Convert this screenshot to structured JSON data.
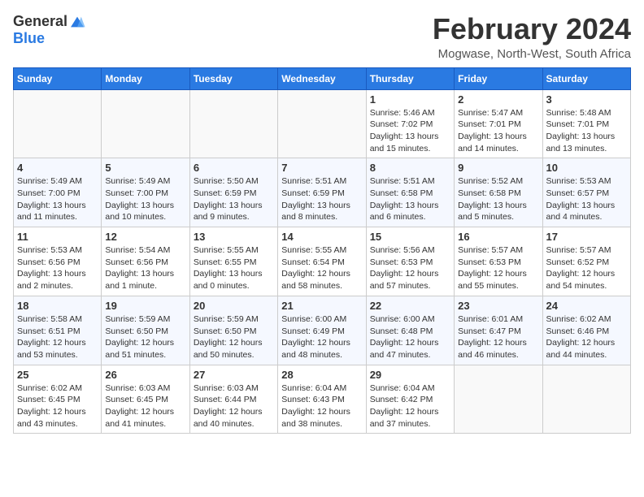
{
  "logo": {
    "general": "General",
    "blue": "Blue"
  },
  "title": "February 2024",
  "location": "Mogwase, North-West, South Africa",
  "days_of_week": [
    "Sunday",
    "Monday",
    "Tuesday",
    "Wednesday",
    "Thursday",
    "Friday",
    "Saturday"
  ],
  "weeks": [
    [
      {
        "day": "",
        "info": ""
      },
      {
        "day": "",
        "info": ""
      },
      {
        "day": "",
        "info": ""
      },
      {
        "day": "",
        "info": ""
      },
      {
        "day": "1",
        "info": "Sunrise: 5:46 AM\nSunset: 7:02 PM\nDaylight: 13 hours\nand 15 minutes."
      },
      {
        "day": "2",
        "info": "Sunrise: 5:47 AM\nSunset: 7:01 PM\nDaylight: 13 hours\nand 14 minutes."
      },
      {
        "day": "3",
        "info": "Sunrise: 5:48 AM\nSunset: 7:01 PM\nDaylight: 13 hours\nand 13 minutes."
      }
    ],
    [
      {
        "day": "4",
        "info": "Sunrise: 5:49 AM\nSunset: 7:00 PM\nDaylight: 13 hours\nand 11 minutes."
      },
      {
        "day": "5",
        "info": "Sunrise: 5:49 AM\nSunset: 7:00 PM\nDaylight: 13 hours\nand 10 minutes."
      },
      {
        "day": "6",
        "info": "Sunrise: 5:50 AM\nSunset: 6:59 PM\nDaylight: 13 hours\nand 9 minutes."
      },
      {
        "day": "7",
        "info": "Sunrise: 5:51 AM\nSunset: 6:59 PM\nDaylight: 13 hours\nand 8 minutes."
      },
      {
        "day": "8",
        "info": "Sunrise: 5:51 AM\nSunset: 6:58 PM\nDaylight: 13 hours\nand 6 minutes."
      },
      {
        "day": "9",
        "info": "Sunrise: 5:52 AM\nSunset: 6:58 PM\nDaylight: 13 hours\nand 5 minutes."
      },
      {
        "day": "10",
        "info": "Sunrise: 5:53 AM\nSunset: 6:57 PM\nDaylight: 13 hours\nand 4 minutes."
      }
    ],
    [
      {
        "day": "11",
        "info": "Sunrise: 5:53 AM\nSunset: 6:56 PM\nDaylight: 13 hours\nand 2 minutes."
      },
      {
        "day": "12",
        "info": "Sunrise: 5:54 AM\nSunset: 6:56 PM\nDaylight: 13 hours\nand 1 minute."
      },
      {
        "day": "13",
        "info": "Sunrise: 5:55 AM\nSunset: 6:55 PM\nDaylight: 13 hours\nand 0 minutes."
      },
      {
        "day": "14",
        "info": "Sunrise: 5:55 AM\nSunset: 6:54 PM\nDaylight: 12 hours\nand 58 minutes."
      },
      {
        "day": "15",
        "info": "Sunrise: 5:56 AM\nSunset: 6:53 PM\nDaylight: 12 hours\nand 57 minutes."
      },
      {
        "day": "16",
        "info": "Sunrise: 5:57 AM\nSunset: 6:53 PM\nDaylight: 12 hours\nand 55 minutes."
      },
      {
        "day": "17",
        "info": "Sunrise: 5:57 AM\nSunset: 6:52 PM\nDaylight: 12 hours\nand 54 minutes."
      }
    ],
    [
      {
        "day": "18",
        "info": "Sunrise: 5:58 AM\nSunset: 6:51 PM\nDaylight: 12 hours\nand 53 minutes."
      },
      {
        "day": "19",
        "info": "Sunrise: 5:59 AM\nSunset: 6:50 PM\nDaylight: 12 hours\nand 51 minutes."
      },
      {
        "day": "20",
        "info": "Sunrise: 5:59 AM\nSunset: 6:50 PM\nDaylight: 12 hours\nand 50 minutes."
      },
      {
        "day": "21",
        "info": "Sunrise: 6:00 AM\nSunset: 6:49 PM\nDaylight: 12 hours\nand 48 minutes."
      },
      {
        "day": "22",
        "info": "Sunrise: 6:00 AM\nSunset: 6:48 PM\nDaylight: 12 hours\nand 47 minutes."
      },
      {
        "day": "23",
        "info": "Sunrise: 6:01 AM\nSunset: 6:47 PM\nDaylight: 12 hours\nand 46 minutes."
      },
      {
        "day": "24",
        "info": "Sunrise: 6:02 AM\nSunset: 6:46 PM\nDaylight: 12 hours\nand 44 minutes."
      }
    ],
    [
      {
        "day": "25",
        "info": "Sunrise: 6:02 AM\nSunset: 6:45 PM\nDaylight: 12 hours\nand 43 minutes."
      },
      {
        "day": "26",
        "info": "Sunrise: 6:03 AM\nSunset: 6:45 PM\nDaylight: 12 hours\nand 41 minutes."
      },
      {
        "day": "27",
        "info": "Sunrise: 6:03 AM\nSunset: 6:44 PM\nDaylight: 12 hours\nand 40 minutes."
      },
      {
        "day": "28",
        "info": "Sunrise: 6:04 AM\nSunset: 6:43 PM\nDaylight: 12 hours\nand 38 minutes."
      },
      {
        "day": "29",
        "info": "Sunrise: 6:04 AM\nSunset: 6:42 PM\nDaylight: 12 hours\nand 37 minutes."
      },
      {
        "day": "",
        "info": ""
      },
      {
        "day": "",
        "info": ""
      }
    ]
  ]
}
